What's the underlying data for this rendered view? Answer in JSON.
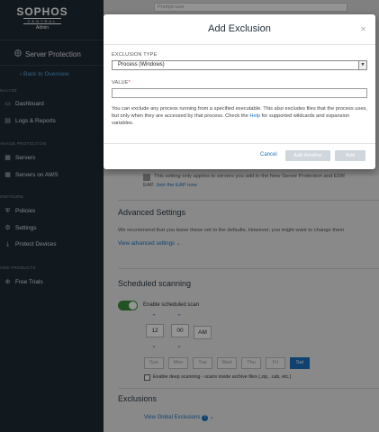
{
  "sidebar": {
    "brand": "SOPHOS",
    "brand_sub": "CENTRAL",
    "role": "Admin",
    "product": "Server Protection",
    "back": "Back to Overview",
    "sections": {
      "analyze": "NALYZE",
      "manage": "ANAGE PROTECTION",
      "configure": "ONFIGURE",
      "more": "ORE PRODUCTS"
    },
    "items": {
      "dashboard": "Dashboard",
      "logs": "Logs & Reports",
      "servers": "Servers",
      "servers_aws": "Servers on AWS",
      "policies": "Policies",
      "settings": "Settings",
      "installers": "Protect Devices",
      "trials": "Free Trials"
    }
  },
  "main": {
    "prompt_field": "Prompt user",
    "eap_note": "This setting only applies to servers you add to the New Server Protection and EDR",
    "eap_prefix": "EAP.",
    "eap_link": "Join the EAP now",
    "advanced": {
      "title": "Advanced Settings",
      "text": "We recommend that you leave these set to the defaults. However, you might want to change them",
      "link": "View advanced settings"
    },
    "scan": {
      "title": "Scheduled scanning",
      "toggle_label": "Enable scheduled scan",
      "hour": "12",
      "minute": "00",
      "ampm": "AM",
      "days": [
        "Sun",
        "Mon",
        "Tue",
        "Wed",
        "Thu",
        "Fri",
        "Sat"
      ],
      "deep_scan": "Enable deep scanning - scans inside archive files (.zip, .cab, etc.)"
    },
    "exclusions": {
      "title": "Exclusions",
      "link": "View Global Exclusions"
    }
  },
  "modal": {
    "title": "Add Exclusion",
    "type_label": "EXCLUSION TYPE",
    "type_value": "Process (Windows)",
    "value_label": "VALUE",
    "value_required": "*",
    "help_text_1": "You can exclude any process running from a specified executable. This also excludes files that the process uses, but only when they are accessed by that process. Check the",
    "help_link": "Help",
    "help_text_2": "for supported wildcards and expansion variables.",
    "cancel": "Cancel",
    "add_another": "Add Another",
    "add": "Add"
  },
  "colors": {
    "sidebar_bg": "#1f2b35",
    "link": "#1a73c0",
    "toggle_on": "#3c8e3c",
    "disabled_btn": "#cfd6dc"
  }
}
